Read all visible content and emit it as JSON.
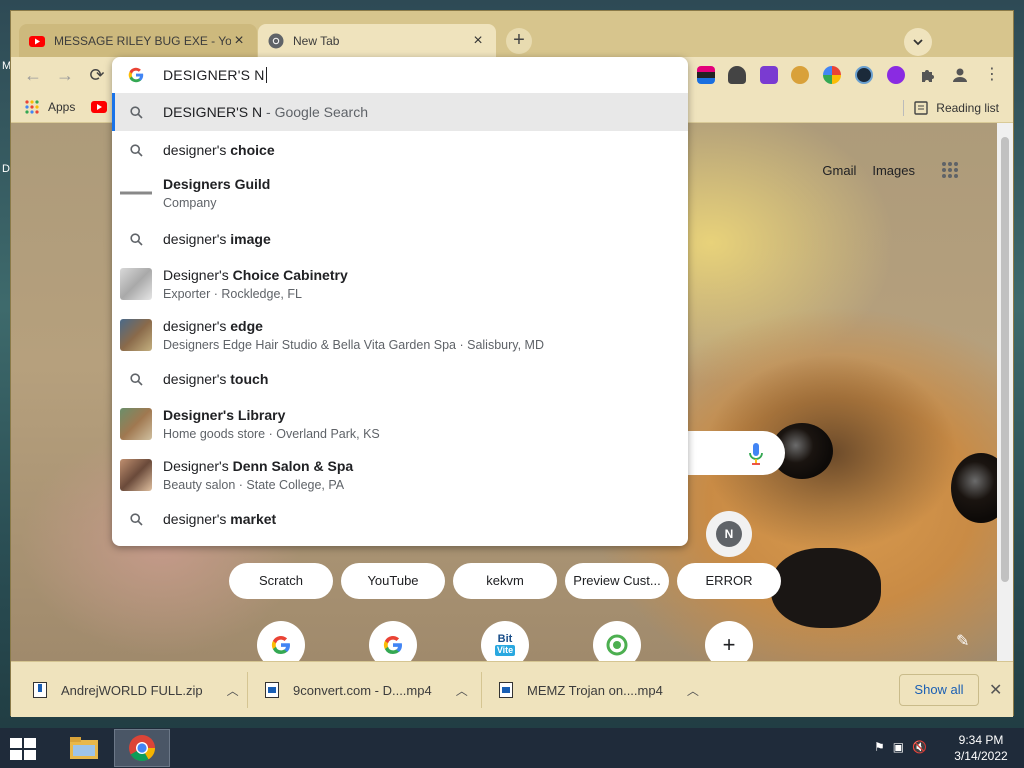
{
  "desktop": {
    "label_top": "M",
    "label_mid": "D"
  },
  "tabs": [
    {
      "title": "MESSAGE RILEY BUG EXE - YouTube",
      "favicon": "youtube-icon"
    },
    {
      "title": "New Tab",
      "favicon": "chrome-icon"
    }
  ],
  "bookmarks": {
    "apps_label": "Apps",
    "reading_list_label": "Reading list"
  },
  "omnibox": {
    "query": "DESIGNER'S N",
    "suggestions": [
      {
        "main": "DESIGNER'S N",
        "hint": " - Google Search",
        "icon": "search-icon"
      },
      {
        "main_plain": "designer's ",
        "main_bold": "choice",
        "icon": "search-icon"
      },
      {
        "main_plain": "",
        "main_bold": "Designers Guild",
        "sub": "Company"
      },
      {
        "main_plain": "designer's ",
        "main_bold": "image",
        "icon": "search-icon"
      },
      {
        "main_plain": "Designer's ",
        "main_bold": "Choice Cabinetry",
        "sub": "Exporter · Rockledge, FL"
      },
      {
        "main_plain": "designer's ",
        "main_bold": "edge",
        "sub": "Designers Edge Hair Studio & Bella Vita Garden Spa · Salisbury, MD"
      },
      {
        "main_plain": "designer's ",
        "main_bold": "touch",
        "icon": "search-icon"
      },
      {
        "main_plain": "",
        "main_bold": "Designer's Library",
        "sub": "Home goods store · Overland Park, KS"
      },
      {
        "main_plain": "Designer's ",
        "main_bold": "Denn Salon & Spa",
        "sub": "Beauty salon · State College, PA"
      },
      {
        "main_plain": "designer's ",
        "main_bold": "market",
        "icon": "search-icon"
      }
    ]
  },
  "newtab": {
    "gmail": "Gmail",
    "images": "Images",
    "n_avatar": "N",
    "shortcuts": [
      "Scratch",
      "YouTube",
      "kekvm",
      "Preview Cust...",
      "ERROR"
    ],
    "tile_bit_top": "Bit",
    "tile_bit_bottom": "Vite"
  },
  "downloads": {
    "items": [
      "AndrejWORLD FULL.zip",
      "9convert.com - D....mp4",
      "MEMZ Trojan on....mp4"
    ],
    "show_all": "Show all"
  },
  "taskbar": {
    "time": "9:34 PM",
    "date": "3/14/2022"
  }
}
